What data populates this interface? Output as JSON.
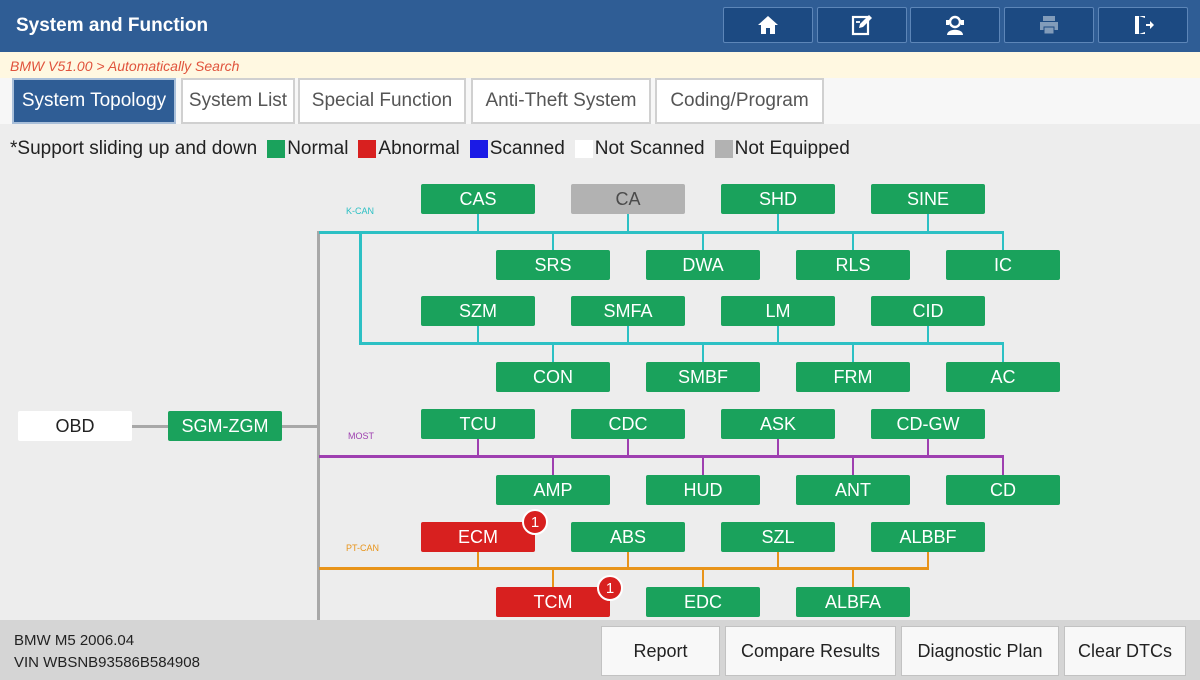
{
  "header": {
    "title": "System and Function",
    "buttons": [
      {
        "icon": "home-icon"
      },
      {
        "icon": "edit-icon"
      },
      {
        "icon": "support-icon"
      },
      {
        "icon": "print-icon",
        "disabled": true
      },
      {
        "icon": "exit-icon"
      }
    ]
  },
  "breadcrumb": "BMW V51.00 > Automatically Search",
  "tabs": [
    "System Topology",
    "System List",
    "Special Function",
    "Anti-Theft System",
    "Coding/Program"
  ],
  "active_tab": "System Topology",
  "legend": {
    "note": "*Support sliding up and down",
    "items": [
      {
        "label": "Normal",
        "color": "#1aa25c"
      },
      {
        "label": "Abnormal",
        "color": "#d8201f"
      },
      {
        "label": "Scanned",
        "color": "#1a1ae6"
      },
      {
        "label": "Not Scanned",
        "color": "#ffffff"
      },
      {
        "label": "Not Equipped",
        "color": "#b2b2b2"
      }
    ]
  },
  "colors": {
    "normal": "#1aa25c",
    "abnormal": "#d8201f",
    "not_equipped": "#b2b2b2",
    "kcan_line": "#2cc0c4",
    "most_line": "#9e3fb0",
    "ptcan_line": "#e8941a",
    "trunk_line": "#a8a8a8"
  },
  "topology": {
    "obd": "OBD",
    "gateway": "SGM-ZGM",
    "buses": {
      "kcan": {
        "label": "K-CAN",
        "modules": [
          {
            "name": "CAS",
            "status": "normal"
          },
          {
            "name": "CA",
            "status": "not_equipped"
          },
          {
            "name": "SHD",
            "status": "normal"
          },
          {
            "name": "SINE",
            "status": "normal"
          },
          {
            "name": "SRS",
            "status": "normal"
          },
          {
            "name": "DWA",
            "status": "normal"
          },
          {
            "name": "RLS",
            "status": "normal"
          },
          {
            "name": "IC",
            "status": "normal"
          },
          {
            "name": "SZM",
            "status": "normal"
          },
          {
            "name": "SMFA",
            "status": "normal"
          },
          {
            "name": "LM",
            "status": "normal"
          },
          {
            "name": "CID",
            "status": "normal"
          },
          {
            "name": "CON",
            "status": "normal"
          },
          {
            "name": "SMBF",
            "status": "normal"
          },
          {
            "name": "FRM",
            "status": "normal"
          },
          {
            "name": "AC",
            "status": "normal"
          }
        ]
      },
      "most": {
        "label": "MOST",
        "modules": [
          {
            "name": "TCU",
            "status": "normal"
          },
          {
            "name": "CDC",
            "status": "normal"
          },
          {
            "name": "ASK",
            "status": "normal"
          },
          {
            "name": "CD-GW",
            "status": "normal"
          },
          {
            "name": "AMP",
            "status": "normal"
          },
          {
            "name": "HUD",
            "status": "normal"
          },
          {
            "name": "ANT",
            "status": "normal"
          },
          {
            "name": "CD",
            "status": "normal"
          }
        ]
      },
      "ptcan": {
        "label": "PT-CAN",
        "modules": [
          {
            "name": "ECM",
            "status": "abnormal",
            "dtc_count": "1"
          },
          {
            "name": "ABS",
            "status": "normal"
          },
          {
            "name": "SZL",
            "status": "normal"
          },
          {
            "name": "ALBBF",
            "status": "normal"
          },
          {
            "name": "TCM",
            "status": "abnormal",
            "dtc_count": "1"
          },
          {
            "name": "EDC",
            "status": "normal"
          },
          {
            "name": "ALBFA",
            "status": "normal"
          }
        ]
      }
    }
  },
  "vehicle": {
    "model": "BMW M5 2006.04",
    "vin": "VIN WBSNB93586B584908"
  },
  "footer_buttons": [
    "Report",
    "Compare Results",
    "Diagnostic Plan",
    "Clear DTCs"
  ]
}
